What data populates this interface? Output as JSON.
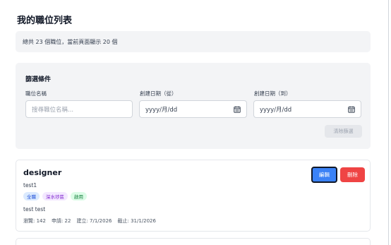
{
  "page": {
    "title": "我的職位列表",
    "summary": "總共 23 個職位，當前頁面顯示 20 個"
  },
  "filters": {
    "title": "篩選條件",
    "job_name_label": "職位名稱",
    "job_name_placeholder": "搜尋職位名稱...",
    "created_from_label": "創建日期（從）",
    "created_from_value": "yyyy/月/dd",
    "created_to_label": "創建日期（到）",
    "created_to_value": "yyyy/月/dd",
    "calendar_icon": "calendar-icon",
    "clear_label": "清除篩選"
  },
  "jobs": [
    {
      "title": "designer",
      "subtitle": "test1",
      "tags": [
        "全職",
        "深水埗區",
        "啟用"
      ],
      "description": "test test",
      "views": "瀏覽: 142",
      "applications": "申請: 22",
      "created": "建立: 7/1/2026",
      "deadline": "截止: 31/1/2026",
      "edit_label": "編輯",
      "delete_label": "刪除"
    }
  ],
  "colors": {
    "primary": "#3b82f6",
    "danger": "#ef4444",
    "panel": "#f3f4f6"
  }
}
